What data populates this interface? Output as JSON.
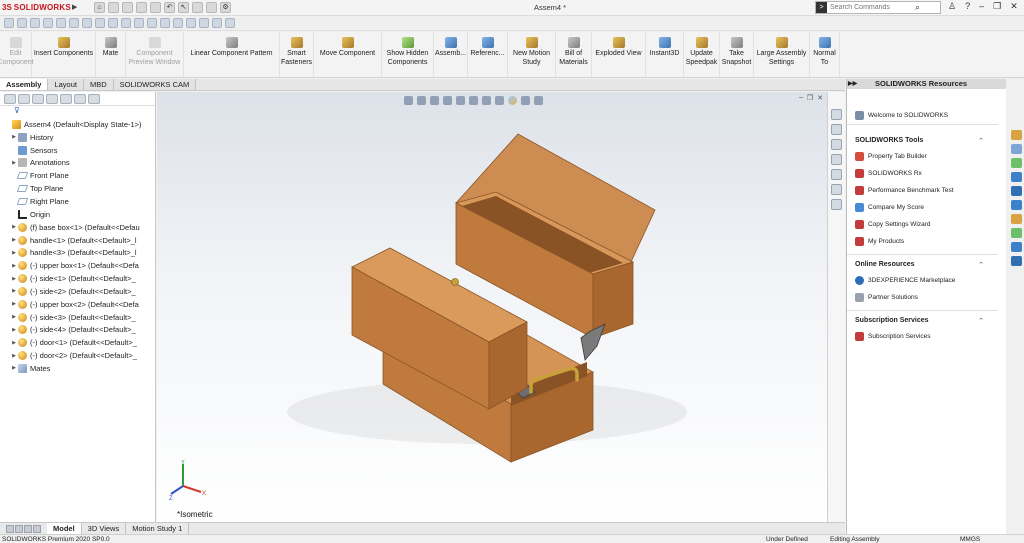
{
  "app": {
    "logo_ds": "3S",
    "logo_text": "SOLIDWORKS",
    "document_title": "Assem4 *"
  },
  "search": {
    "placeholder": "Search Commands"
  },
  "ribbon": {
    "buttons": [
      {
        "label": "Edit\nComponent",
        "enabled": false,
        "icon": "edit-component-icon"
      },
      {
        "label": "Insert Components",
        "enabled": true,
        "icon": "insert-components-icon"
      },
      {
        "label": "Mate",
        "enabled": true,
        "icon": "mate-icon"
      },
      {
        "label": "Component\nPreview Window",
        "enabled": false,
        "icon": "component-preview-icon"
      },
      {
        "label": "Linear Component Pattern",
        "enabled": true,
        "icon": "linear-pattern-icon"
      },
      {
        "label": "Smart\nFasteners",
        "enabled": true,
        "icon": "smart-fasteners-icon"
      },
      {
        "label": "Move Component",
        "enabled": true,
        "icon": "move-component-icon"
      },
      {
        "label": "Show Hidden\nComponents",
        "enabled": true,
        "icon": "show-hidden-icon"
      },
      {
        "label": "Assemb...",
        "enabled": true,
        "icon": "assembly-features-icon"
      },
      {
        "label": "Referenc...",
        "enabled": true,
        "icon": "reference-geometry-icon"
      },
      {
        "label": "New Motion\nStudy",
        "enabled": true,
        "icon": "motion-study-icon"
      },
      {
        "label": "Bill of\nMaterials",
        "enabled": true,
        "icon": "bom-icon"
      },
      {
        "label": "Exploded View",
        "enabled": true,
        "icon": "exploded-view-icon"
      },
      {
        "label": "Instant3D",
        "enabled": true,
        "icon": "instant3d-icon"
      },
      {
        "label": "Update\nSpeedpak",
        "enabled": true,
        "icon": "speedpak-icon"
      },
      {
        "label": "Take\nSnapshot",
        "enabled": true,
        "icon": "snapshot-icon"
      },
      {
        "label": "Large Assembly\nSettings",
        "enabled": true,
        "icon": "large-assembly-icon"
      },
      {
        "label": "Normal\nTo",
        "enabled": true,
        "icon": "normal-to-icon"
      }
    ]
  },
  "tabs": [
    {
      "label": "Assembly",
      "active": true
    },
    {
      "label": "Layout",
      "active": false
    },
    {
      "label": "MBD",
      "active": false
    },
    {
      "label": "SOLIDWORKS CAM",
      "active": false
    }
  ],
  "tree": {
    "items": [
      {
        "label": "Assem4  (Default<Display State-1>)",
        "icon": "asm",
        "expand": ""
      },
      {
        "label": "History",
        "icon": "folder",
        "expand": "▶"
      },
      {
        "label": "Sensors",
        "icon": "sensor",
        "expand": ""
      },
      {
        "label": "Annotations",
        "icon": "anno",
        "expand": "▶"
      },
      {
        "label": "Front Plane",
        "icon": "plane",
        "expand": ""
      },
      {
        "label": "Top Plane",
        "icon": "plane",
        "expand": ""
      },
      {
        "label": "Right Plane",
        "icon": "plane",
        "expand": ""
      },
      {
        "label": "Origin",
        "icon": "origin",
        "expand": ""
      },
      {
        "label": "(f) base box<1> (Default<<Defau",
        "icon": "part",
        "expand": "▶"
      },
      {
        "label": "handle<1> (Default<<Default>_l",
        "icon": "part",
        "expand": "▶"
      },
      {
        "label": "handle<3> (Default<<Default>_l",
        "icon": "part",
        "expand": "▶"
      },
      {
        "label": "(-) upper box<1> (Default<<Defa",
        "icon": "part",
        "expand": "▶"
      },
      {
        "label": "(-) side<1> (Default<<Default>_",
        "icon": "part",
        "expand": "▶"
      },
      {
        "label": "(-) side<2> (Default<<Default>_",
        "icon": "part",
        "expand": "▶"
      },
      {
        "label": "(-) upper box<2> (Default<<Defa",
        "icon": "part",
        "expand": "▶"
      },
      {
        "label": "(-) side<3> (Default<<Default>_",
        "icon": "part",
        "expand": "▶"
      },
      {
        "label": "(-) side<4> (Default<<Default>_",
        "icon": "part",
        "expand": "▶"
      },
      {
        "label": "(-) door<1> (Default<<Default>_",
        "icon": "part",
        "expand": "▶"
      },
      {
        "label": "(-) door<2> (Default<<Default>_",
        "icon": "part",
        "expand": "▶"
      },
      {
        "label": "Mates",
        "icon": "mates",
        "expand": "▶"
      }
    ]
  },
  "viewport": {
    "view_label": "*Isometric"
  },
  "bottom_tabs": [
    {
      "label": "Model",
      "active": true
    },
    {
      "label": "3D Views",
      "active": false
    },
    {
      "label": "Motion Study 1",
      "active": false
    }
  ],
  "status": {
    "left": "SOLIDWORKS Premium 2020 SP0.0",
    "under_defined": "Under Defined",
    "editing": "Editing Assembly",
    "units": "MMGS"
  },
  "resources": {
    "title": "SOLIDWORKS Resources",
    "welcome": "Welcome to SOLIDWORKS",
    "sections": [
      {
        "title": "SOLIDWORKS Tools",
        "items": [
          "Property Tab Builder",
          "SOLIDWORKS Rx",
          "Performance Benchmark Test",
          "Compare My Score",
          "Copy Settings Wizard",
          "My Products"
        ]
      },
      {
        "title": "Online Resources",
        "items": [
          "3DEXPERIENCE Marketplace",
          "Partner Solutions"
        ]
      },
      {
        "title": "Subscription Services",
        "items": [
          "Subscription Services"
        ]
      }
    ]
  },
  "colors": {
    "wood_top": "#d99a5c",
    "wood_front": "#c07a3e",
    "wood_side": "#a9672f",
    "wood_inner": "#8a5325",
    "brand_red": "#c4161c"
  }
}
